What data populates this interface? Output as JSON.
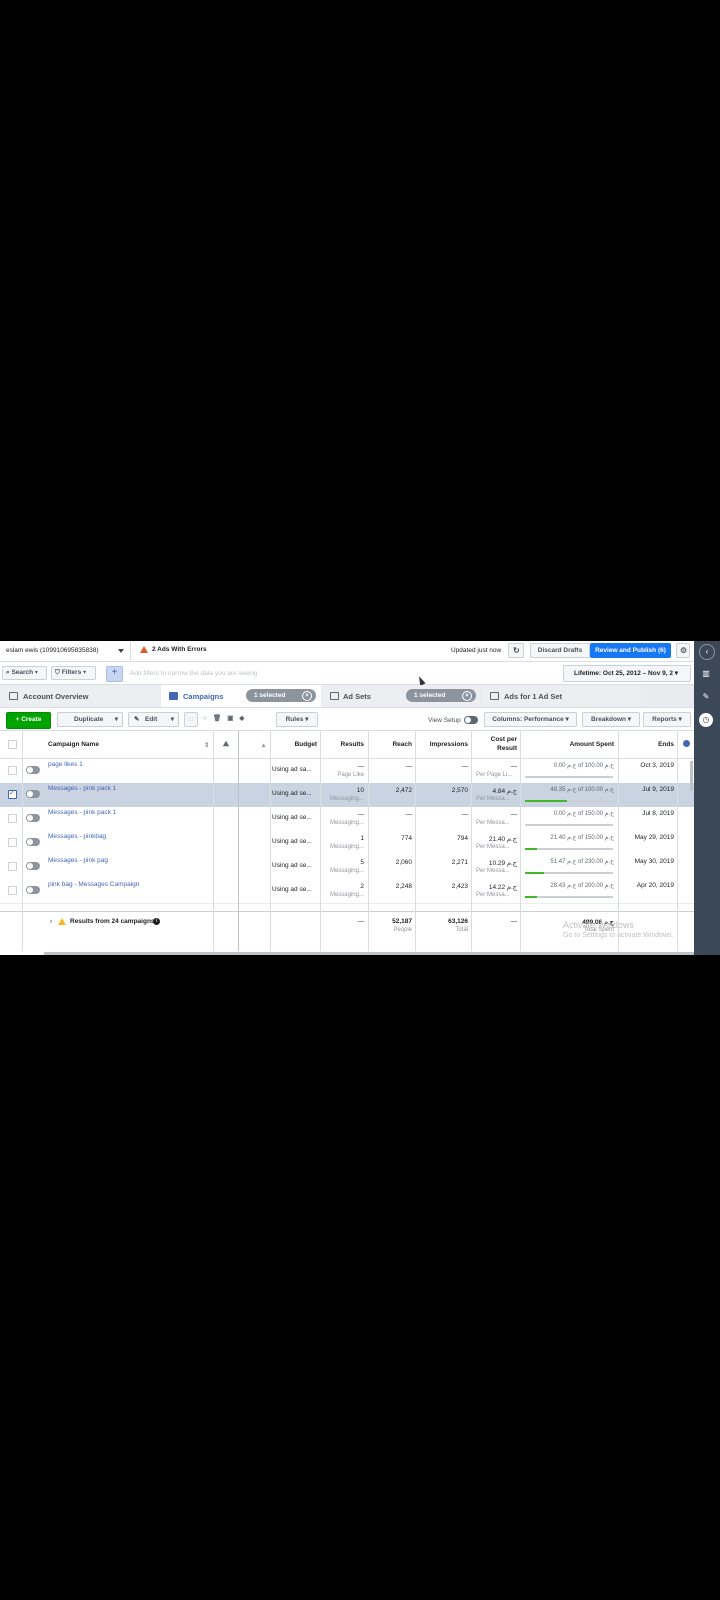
{
  "topbar": {
    "account": "eslam ewis (109910695835838)",
    "errors": "2 Ads With Errors",
    "updated": "Updated just now",
    "discard": "Discard Drafts",
    "publish": "Review and Publish (6)"
  },
  "filterbar": {
    "search": "Search",
    "filters": "Filters",
    "plus": "+",
    "placeholder": "Add filters to narrow the data you are seeing",
    "lifetime": "Lifetime: Oct 25, 2012 – Nov 9, 2"
  },
  "tabs": [
    {
      "label": "Account Overview"
    },
    {
      "label": "Campaigns",
      "badge": "1 selected"
    },
    {
      "label": "Ad Sets",
      "badge": "1 selected"
    },
    {
      "label": "Ads for 1 Ad Set"
    }
  ],
  "toolbar": {
    "create": "Create",
    "duplicate": "Duplicate",
    "edit": "Edit",
    "rules": "Rules",
    "view_setup": "View Setup",
    "columns": "Columns: Performance",
    "breakdown": "Breakdown",
    "reports": "Reports"
  },
  "columns": {
    "name": "Campaign Name",
    "budget": "Budget",
    "results": "Results",
    "reach": "Reach",
    "impressions": "Impressions",
    "cost": "Cost per Result",
    "spent": "Amount Spent",
    "ends": "Ends"
  },
  "rows": [
    {
      "name": "page likes 1",
      "budget": "Using ad sa...",
      "results": "—",
      "results_sub": "Page Like",
      "reach": "—",
      "impressions": "—",
      "cost": "—",
      "cost_sub": "Per Page Li...",
      "spent": "0.00 ج.م of 100.00 ج.م",
      "spent_fraction": 0.0,
      "ends": "Oct 3, 2019"
    },
    {
      "name": "Messages - pink pack 1",
      "budget": "Using ad se...",
      "results": "10",
      "results_sub": "Messaging...",
      "reach": "2,472",
      "impressions": "2,570",
      "cost": "4.84 ج.م",
      "cost_sub": "Per Messa...",
      "spent": "48.35 ج.م of 100.00 ج.م",
      "spent_fraction": 0.48,
      "ends": "Jul 9, 2019"
    },
    {
      "name": "Messages - pink pack 1",
      "budget": "Using ad se...",
      "results": "—",
      "results_sub": "Messaging...",
      "reach": "—",
      "impressions": "—",
      "cost": "—",
      "cost_sub": "Per Messa...",
      "spent": "0.00 ج.م of 150.00 ج.م",
      "spent_fraction": 0.0,
      "ends": "Jul 8, 2019"
    },
    {
      "name": "Messages - pinkbag",
      "budget": "Using ad se...",
      "results": "1",
      "results_sub": "Messaging...",
      "reach": "774",
      "impressions": "794",
      "cost": "21.40 ج.م",
      "cost_sub": "Per Messa...",
      "spent": "21.40 ج.م of 150.00 ج.م",
      "spent_fraction": 0.14,
      "ends": "May 29, 2019"
    },
    {
      "name": "Messages - pink pag",
      "budget": "Using ad se...",
      "results": "5",
      "results_sub": "Messaging...",
      "reach": "2,060",
      "impressions": "2,271",
      "cost": "10.29 ج.م",
      "cost_sub": "Per Messa...",
      "spent": "51.47 ج.م of 230.00 ج.م",
      "spent_fraction": 0.22,
      "ends": "May 30, 2019"
    },
    {
      "name": "pink bag - Messages Campaign",
      "budget": "Using ad se...",
      "results": "2",
      "results_sub": "Messaging...",
      "reach": "2,248",
      "impressions": "2,423",
      "cost": "14.22 ج.م",
      "cost_sub": "Per Messa...",
      "spent": "28.43 ج.م of 200.00 ج.م",
      "spent_fraction": 0.14,
      "ends": "Apr 20, 2019"
    }
  ],
  "footer": {
    "label": "Results from 24 campaigns",
    "results": "—",
    "reach": "52,187",
    "reach_sub": "People",
    "impressions": "63,126",
    "impressions_sub": "Total",
    "cost": "—",
    "spent": "499.06 ج.م",
    "spent_sub": "Total Spent"
  },
  "watermark": {
    "line1": "Activate Windows",
    "line2": "Go to Settings to activate Windows."
  }
}
